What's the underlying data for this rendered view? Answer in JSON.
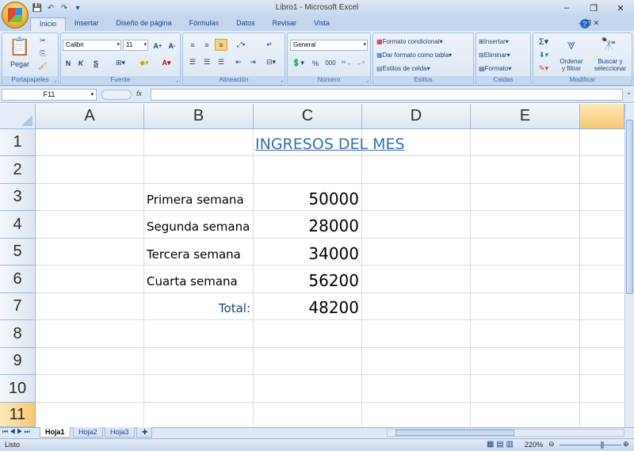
{
  "window": {
    "title": "Libro1 - Microsoft Excel"
  },
  "qat": {
    "save": "💾",
    "undo": "↶",
    "redo": "↷",
    "customize": "▾"
  },
  "tabs": [
    "Inicio",
    "Insertar",
    "Diseño de página",
    "Fórmulas",
    "Datos",
    "Revisar",
    "Vista"
  ],
  "ribbon": {
    "clipboard": {
      "paste": "Pegar",
      "label": "Portapapeles"
    },
    "font": {
      "name": "Calibri",
      "size": "11",
      "bold": "N",
      "italic": "K",
      "underline": "S",
      "label": "Fuente"
    },
    "alignment": {
      "label": "Alineación"
    },
    "number": {
      "format": "General",
      "percent": "%",
      "thousands": "000",
      "label": "Número"
    },
    "styles": {
      "conditional": "Formato condicional",
      "table": "Dar formato como tabla",
      "cell_styles": "Estilos de celda",
      "label": "Estilos"
    },
    "cells": {
      "insert": "Insertar",
      "delete": "Eliminar",
      "format": "Formato",
      "label": "Celdas"
    },
    "editing": {
      "sort": "Ordenar\ny filtrar",
      "find": "Buscar y\nseleccionar",
      "label": "Modificar"
    }
  },
  "formula_bar": {
    "name_box": "F11",
    "fx": "fx",
    "value": ""
  },
  "columns": [
    "A",
    "B",
    "C",
    "D",
    "E"
  ],
  "rows": [
    "1",
    "2",
    "3",
    "4",
    "5",
    "6",
    "7",
    "8",
    "9",
    "10",
    "11"
  ],
  "cells": {
    "title": "INGRESOS DEL MES",
    "labels": [
      "Primera semana",
      "Segunda semana",
      "Tercera semana",
      "Cuarta semana"
    ],
    "values": [
      "50000",
      "28000",
      "34000",
      "56200"
    ],
    "total_label": "Total:",
    "total_value": "48200"
  },
  "sheets": [
    "Hoja1",
    "Hoja2",
    "Hoja3"
  ],
  "status": {
    "ready": "Listo",
    "zoom": "220%"
  },
  "colors": {
    "title_color": "#376fb0",
    "selection": "#f6c872"
  }
}
